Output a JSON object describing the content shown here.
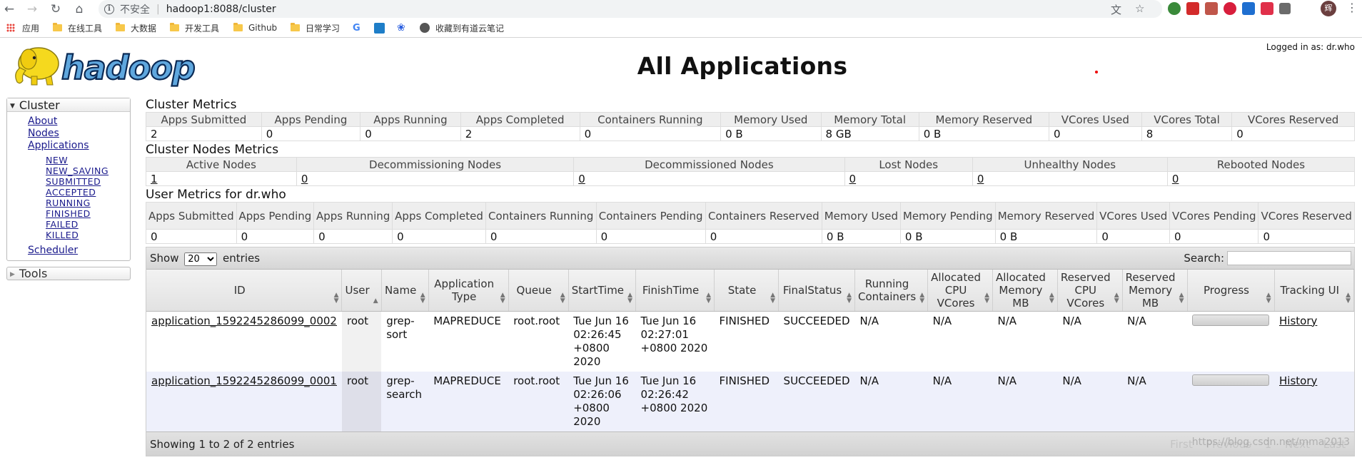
{
  "browser": {
    "insecure_label": "不安全",
    "url": "hadoop1:8088/cluster",
    "profile_initial": "辉",
    "bookmarks": [
      {
        "label": "应用",
        "kind": "apps"
      },
      {
        "label": "在线工具",
        "kind": "folder"
      },
      {
        "label": "大数据",
        "kind": "folder"
      },
      {
        "label": "开发工具",
        "kind": "folder"
      },
      {
        "label": "Github",
        "kind": "folder"
      },
      {
        "label": "日常学习",
        "kind": "folder"
      },
      {
        "label": "收藏到有道云笔记",
        "kind": "link"
      }
    ]
  },
  "header": {
    "title": "All Applications",
    "logged_in": "Logged in as: dr.who"
  },
  "nav": {
    "cluster_label": "Cluster",
    "items": [
      "About",
      "Nodes",
      "Applications"
    ],
    "app_states": [
      "NEW",
      "NEW_SAVING",
      "SUBMITTED",
      "ACCEPTED",
      "RUNNING",
      "FINISHED",
      "FAILED",
      "KILLED"
    ],
    "scheduler": "Scheduler",
    "tools_label": "Tools"
  },
  "cluster_metrics": {
    "title": "Cluster Metrics",
    "headers": [
      "Apps Submitted",
      "Apps Pending",
      "Apps Running",
      "Apps Completed",
      "Containers Running",
      "Memory Used",
      "Memory Total",
      "Memory Reserved",
      "VCores Used",
      "VCores Total",
      "VCores Reserved"
    ],
    "values": [
      "2",
      "0",
      "0",
      "2",
      "0",
      "0 B",
      "8 GB",
      "0 B",
      "0",
      "8",
      "0"
    ]
  },
  "node_metrics": {
    "title": "Cluster Nodes Metrics",
    "headers": [
      "Active Nodes",
      "Decommissioning Nodes",
      "Decommissioned Nodes",
      "Lost Nodes",
      "Unhealthy Nodes",
      "Rebooted Nodes"
    ],
    "values": [
      "1",
      "0",
      "0",
      "0",
      "0",
      "0"
    ]
  },
  "user_metrics": {
    "title": "User Metrics for dr.who",
    "headers": [
      "Apps Submitted",
      "Apps Pending",
      "Apps Running",
      "Apps Completed",
      "Containers Running",
      "Containers Pending",
      "Containers Reserved",
      "Memory Used",
      "Memory Pending",
      "Memory Reserved",
      "VCores Used",
      "VCores Pending",
      "VCores Reserved"
    ],
    "values": [
      "0",
      "0",
      "0",
      "0",
      "0",
      "0",
      "0",
      "0 B",
      "0 B",
      "0 B",
      "0",
      "0",
      "0"
    ]
  },
  "apps_table": {
    "show_label": "Show",
    "page_size": "20",
    "entries_label": "entries",
    "search_label": "Search:",
    "headers": [
      "ID",
      "User",
      "Name",
      "Application Type",
      "Queue",
      "StartTime",
      "FinishTime",
      "State",
      "FinalStatus",
      "Running Containers",
      "Allocated CPU VCores",
      "Allocated Memory MB",
      "Reserved CPU VCores",
      "Reserved Memory MB",
      "Progress",
      "Tracking UI"
    ],
    "rows": [
      {
        "id": "application_1592245286099_0002",
        "user": "root",
        "name": "grep-sort",
        "type": "MAPREDUCE",
        "queue": "root.root",
        "start": "Tue Jun 16 02:26:45 +0800 2020",
        "finish": "Tue Jun 16 02:27:01 +0800 2020",
        "state": "FINISHED",
        "final_status": "SUCCEEDED",
        "running_containers": "N/A",
        "alloc_vcores": "N/A",
        "alloc_mem": "N/A",
        "res_vcores": "N/A",
        "res_mem": "N/A",
        "progress": 1.0,
        "tracking": "History"
      },
      {
        "id": "application_1592245286099_0001",
        "user": "root",
        "name": "grep-search",
        "type": "MAPREDUCE",
        "queue": "root.root",
        "start": "Tue Jun 16 02:26:06 +0800 2020",
        "finish": "Tue Jun 16 02:26:42 +0800 2020",
        "state": "FINISHED",
        "final_status": "SUCCEEDED",
        "running_containers": "N/A",
        "alloc_vcores": "N/A",
        "alloc_mem": "N/A",
        "res_vcores": "N/A",
        "res_mem": "N/A",
        "progress": 1.0,
        "tracking": "History"
      }
    ],
    "info": "Showing 1 to 2 of 2 entries",
    "paging": [
      "First",
      "Previous",
      "1",
      "Next",
      "Last"
    ]
  },
  "watermark": "https://blog.csdn.net/mma2013"
}
